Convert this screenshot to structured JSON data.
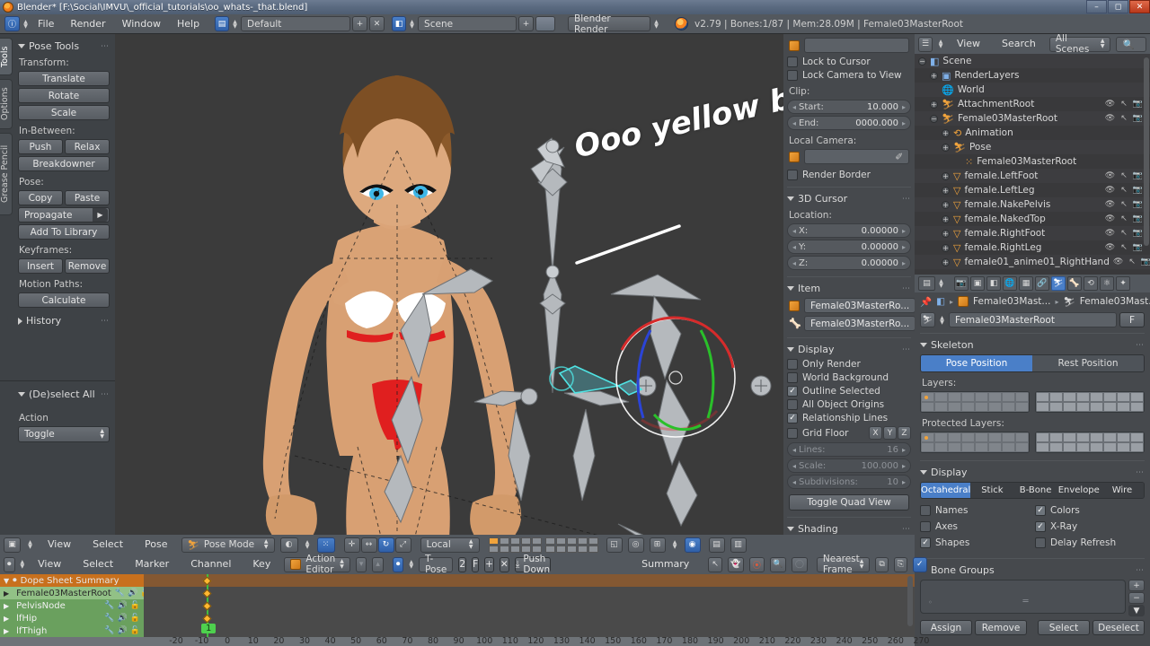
{
  "window": {
    "title": "Blender* [F:\\Social\\IMVU\\_official_tutorials\\oo_whats-_that.blend]",
    "minimize": "–",
    "maximize": "◻",
    "close": "✕"
  },
  "top_header": {
    "menus": [
      "File",
      "Render",
      "Window",
      "Help"
    ],
    "screen_layout": "Default",
    "scene_name": "Scene",
    "engine": "Blender Render",
    "info": "v2.79 | Bones:1/87  | Mem:28.09M | Female03MasterRoot",
    "add_label": "+",
    "remove_label": "✕"
  },
  "tool_shelf": {
    "tabs": [
      "Tools",
      "Options",
      "Grease Pencil"
    ],
    "active_tab": "Tools",
    "panel_title": "Pose Tools",
    "groups": [
      {
        "label": "Transform:",
        "buttons": [
          "Translate",
          "Rotate",
          "Scale"
        ]
      },
      {
        "label": "In-Between:",
        "buttons": [
          "Push",
          "Relax",
          "Breakdowner"
        ]
      },
      {
        "label": "Pose:",
        "buttons": [
          "Copy",
          "Paste",
          "Propagate",
          "Add To Library"
        ]
      },
      {
        "label": "Keyframes:",
        "buttons": [
          "Insert",
          "Remove"
        ]
      },
      {
        "label": "Motion Paths:",
        "buttons": [
          "Calculate"
        ]
      }
    ],
    "history_title": "History"
  },
  "operator_panel": {
    "title": "(De)select All",
    "action_label": "Action",
    "action_value": "Toggle"
  },
  "viewport_header": {
    "menus": [
      "View",
      "Select",
      "Pose"
    ],
    "mode": "Pose Mode",
    "orientation": "Local"
  },
  "n_panel": {
    "lock_to_cursor": "Lock to Cursor",
    "lock_camera_to_view": "Lock Camera to View",
    "clip_label": "Clip:",
    "clip_start_label": "Start:",
    "clip_start_value": "10.000",
    "clip_end_label": "End:",
    "clip_end_value": "0000.000",
    "local_camera_label": "Local Camera:",
    "local_camera_value": "",
    "render_border": "Render Border",
    "cursor_title": "3D Cursor",
    "location_label": "Location:",
    "cursor": [
      {
        "axis": "X:",
        "value": "0.00000"
      },
      {
        "axis": "Y:",
        "value": "0.00000"
      },
      {
        "axis": "Z:",
        "value": "0.00000"
      }
    ],
    "item_title": "Item",
    "item_object": "Female03MasterRo...",
    "item_bone": "Female03MasterRo...",
    "display_title": "Display",
    "display_options": [
      {
        "label": "Only Render",
        "checked": false
      },
      {
        "label": "World Background",
        "checked": false
      },
      {
        "label": "Outline Selected",
        "checked": true
      },
      {
        "label": "All Object Origins",
        "checked": false
      },
      {
        "label": "Relationship Lines",
        "checked": true
      }
    ],
    "grid_floor": "Grid Floor",
    "grid_axes": [
      "X",
      "Y",
      "Z"
    ],
    "grid_fields": [
      {
        "label": "Lines:",
        "value": "16"
      },
      {
        "label": "Scale:",
        "value": "100.000"
      },
      {
        "label": "Subdivisions:",
        "value": "10"
      }
    ],
    "toggle_quad_view": "Toggle Quad View",
    "shading_title": "Shading"
  },
  "outliner": {
    "menus": [
      "View",
      "Search"
    ],
    "scene_filter": "All Scenes",
    "rows": [
      {
        "label": "Scene",
        "indent": 0,
        "icon": "scene-icon",
        "expander": "−"
      },
      {
        "label": "RenderLayers",
        "indent": 1,
        "icon": "renderlayers-icon",
        "expander": "+"
      },
      {
        "label": "World",
        "indent": 1,
        "icon": "world-icon",
        "expander": ""
      },
      {
        "label": "AttachmentRoot",
        "indent": 1,
        "icon": "armature-icon",
        "expander": "+",
        "right_icons": true
      },
      {
        "label": "Female03MasterRoot",
        "indent": 1,
        "icon": "armature-icon",
        "expander": "−",
        "right_icons": true
      },
      {
        "label": "Animation",
        "indent": 2,
        "icon": "animation-icon",
        "expander": "+"
      },
      {
        "label": "Pose",
        "indent": 2,
        "icon": "pose-icon",
        "expander": "+"
      },
      {
        "label": "Female03MasterRoot",
        "indent": 3,
        "icon": "bone-icon",
        "expander": ""
      },
      {
        "label": "female.LeftFoot",
        "indent": 2,
        "icon": "mesh-icon",
        "expander": "+",
        "right_icons": true
      },
      {
        "label": "female.LeftLeg",
        "indent": 2,
        "icon": "mesh-icon",
        "expander": "+",
        "right_icons": true
      },
      {
        "label": "female.NakePelvis",
        "indent": 2,
        "icon": "mesh-icon",
        "expander": "+",
        "right_icons": true
      },
      {
        "label": "female.NakedTop",
        "indent": 2,
        "icon": "mesh-icon",
        "expander": "+",
        "right_icons": true
      },
      {
        "label": "female.RightFoot",
        "indent": 2,
        "icon": "mesh-icon",
        "expander": "+",
        "right_icons": true
      },
      {
        "label": "female.RightLeg",
        "indent": 2,
        "icon": "mesh-icon",
        "expander": "+",
        "right_icons": true
      },
      {
        "label": "female01_anime01_RightHand",
        "indent": 2,
        "icon": "mesh-icon",
        "expander": "+",
        "right_icons": true
      }
    ]
  },
  "properties": {
    "breadcrumb_object": "Female03Mast...",
    "breadcrumb_data": "Female03Mast...",
    "datablock_name": "Female03MasterRoot",
    "fake_user": "F",
    "skeleton_title": "Skeleton",
    "pose_position": "Pose Position",
    "rest_position": "Rest Position",
    "layers_label": "Layers:",
    "protected_layers_label": "Protected Layers:",
    "display_title": "Display",
    "display_modes": [
      "Octahedral",
      "Stick",
      "B-Bone",
      "Envelope",
      "Wire"
    ],
    "display_mode_active": "Octahedral",
    "display_checks": [
      {
        "label": "Names",
        "checked": false
      },
      {
        "label": "Colors",
        "checked": true
      },
      {
        "label": "Axes",
        "checked": false
      },
      {
        "label": "X-Ray",
        "checked": true
      },
      {
        "label": "Shapes",
        "checked": true
      },
      {
        "label": "Delay Refresh",
        "checked": false
      }
    ],
    "bone_groups_title": "Bone Groups",
    "bone_group_buttons": [
      "Assign",
      "Remove",
      "Select",
      "Deselect"
    ],
    "list_add": "+",
    "list_remove": "−",
    "list_menu": "▼"
  },
  "dope_sheet": {
    "menus": [
      "View",
      "Select",
      "Marker",
      "Channel",
      "Key"
    ],
    "editor_mode": "Action Editor",
    "action_name": "T-Pose",
    "users_count": "2",
    "fake_user": "F",
    "add_label": "+",
    "unlink_label": "✕",
    "push_down": "Push Down",
    "summary_label": "Summary",
    "snap_mode": "Nearest Frame",
    "channels": [
      {
        "label": "Dope Sheet Summary",
        "type": "summary"
      },
      {
        "label": "Female03MasterRoot",
        "type": "selected"
      },
      {
        "label": "PelvisNode",
        "type": "normal"
      },
      {
        "label": "lfHip",
        "type": "normal"
      },
      {
        "label": "lfThigh",
        "type": "normal"
      }
    ],
    "current_frame": "1",
    "ruler_ticks": [
      "-20",
      "-10",
      "0",
      "10",
      "20",
      "30",
      "40",
      "50",
      "60",
      "70",
      "80",
      "90",
      "100",
      "110",
      "120",
      "130",
      "140",
      "150",
      "160",
      "170",
      "180",
      "190",
      "200",
      "210",
      "220",
      "230",
      "240",
      "250",
      "260",
      "270"
    ]
  },
  "annotation": {
    "text": "Ooo yellow bits!"
  },
  "colors": {
    "accent_blue": "#4a7fc8",
    "orange": "#c8701d",
    "green_channel": "#6aa05e",
    "bone_grey": "#b0b4b8",
    "skin": "#d8a073"
  }
}
